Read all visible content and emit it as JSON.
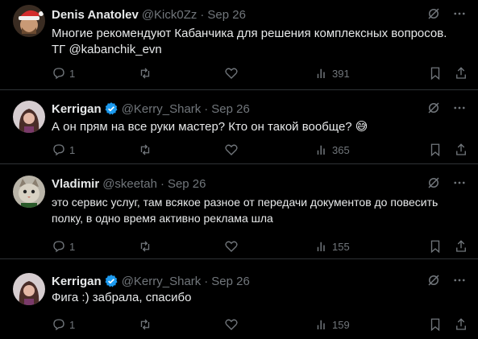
{
  "tweets": [
    {
      "name": "Denis Anatolev",
      "handle": "@Kick0Zz",
      "time": "Sep 26",
      "verified": false,
      "lines": [
        "Многие рекомендуют Кабанчика для решения комплексных вопросов.",
        "ТГ @kabanchik_evn"
      ],
      "replies": "1",
      "views": "391",
      "avatar": "santa-hat"
    },
    {
      "name": "Kerrigan",
      "handle": "@Kerry_Shark",
      "time": "Sep 26",
      "verified": true,
      "lines": [
        "А он прям на все руки мастер? Кто он такой вообще? 😅"
      ],
      "replies": "1",
      "views": "365",
      "avatar": "woman"
    },
    {
      "name": "Vladimir",
      "handle": "@skeetah",
      "time": "Sep 26",
      "verified": false,
      "lines": [
        "это сервис услуг, там всякое разное от передачи документов до повесить",
        "полку, в одно время активно реклама шла"
      ],
      "replies": "1",
      "views": "155",
      "avatar": "cat"
    },
    {
      "name": "Kerrigan",
      "handle": "@Kerry_Shark",
      "time": "Sep 26",
      "verified": true,
      "lines": [
        "Фига :) забрала, спасибо"
      ],
      "replies": "1",
      "views": "159",
      "avatar": "woman"
    }
  ],
  "dot": "·",
  "colors": {
    "background": "#000000",
    "text": "#e7e9ea",
    "muted": "#71767b",
    "verified": "#1d9bf0",
    "divider": "#2f3336"
  }
}
